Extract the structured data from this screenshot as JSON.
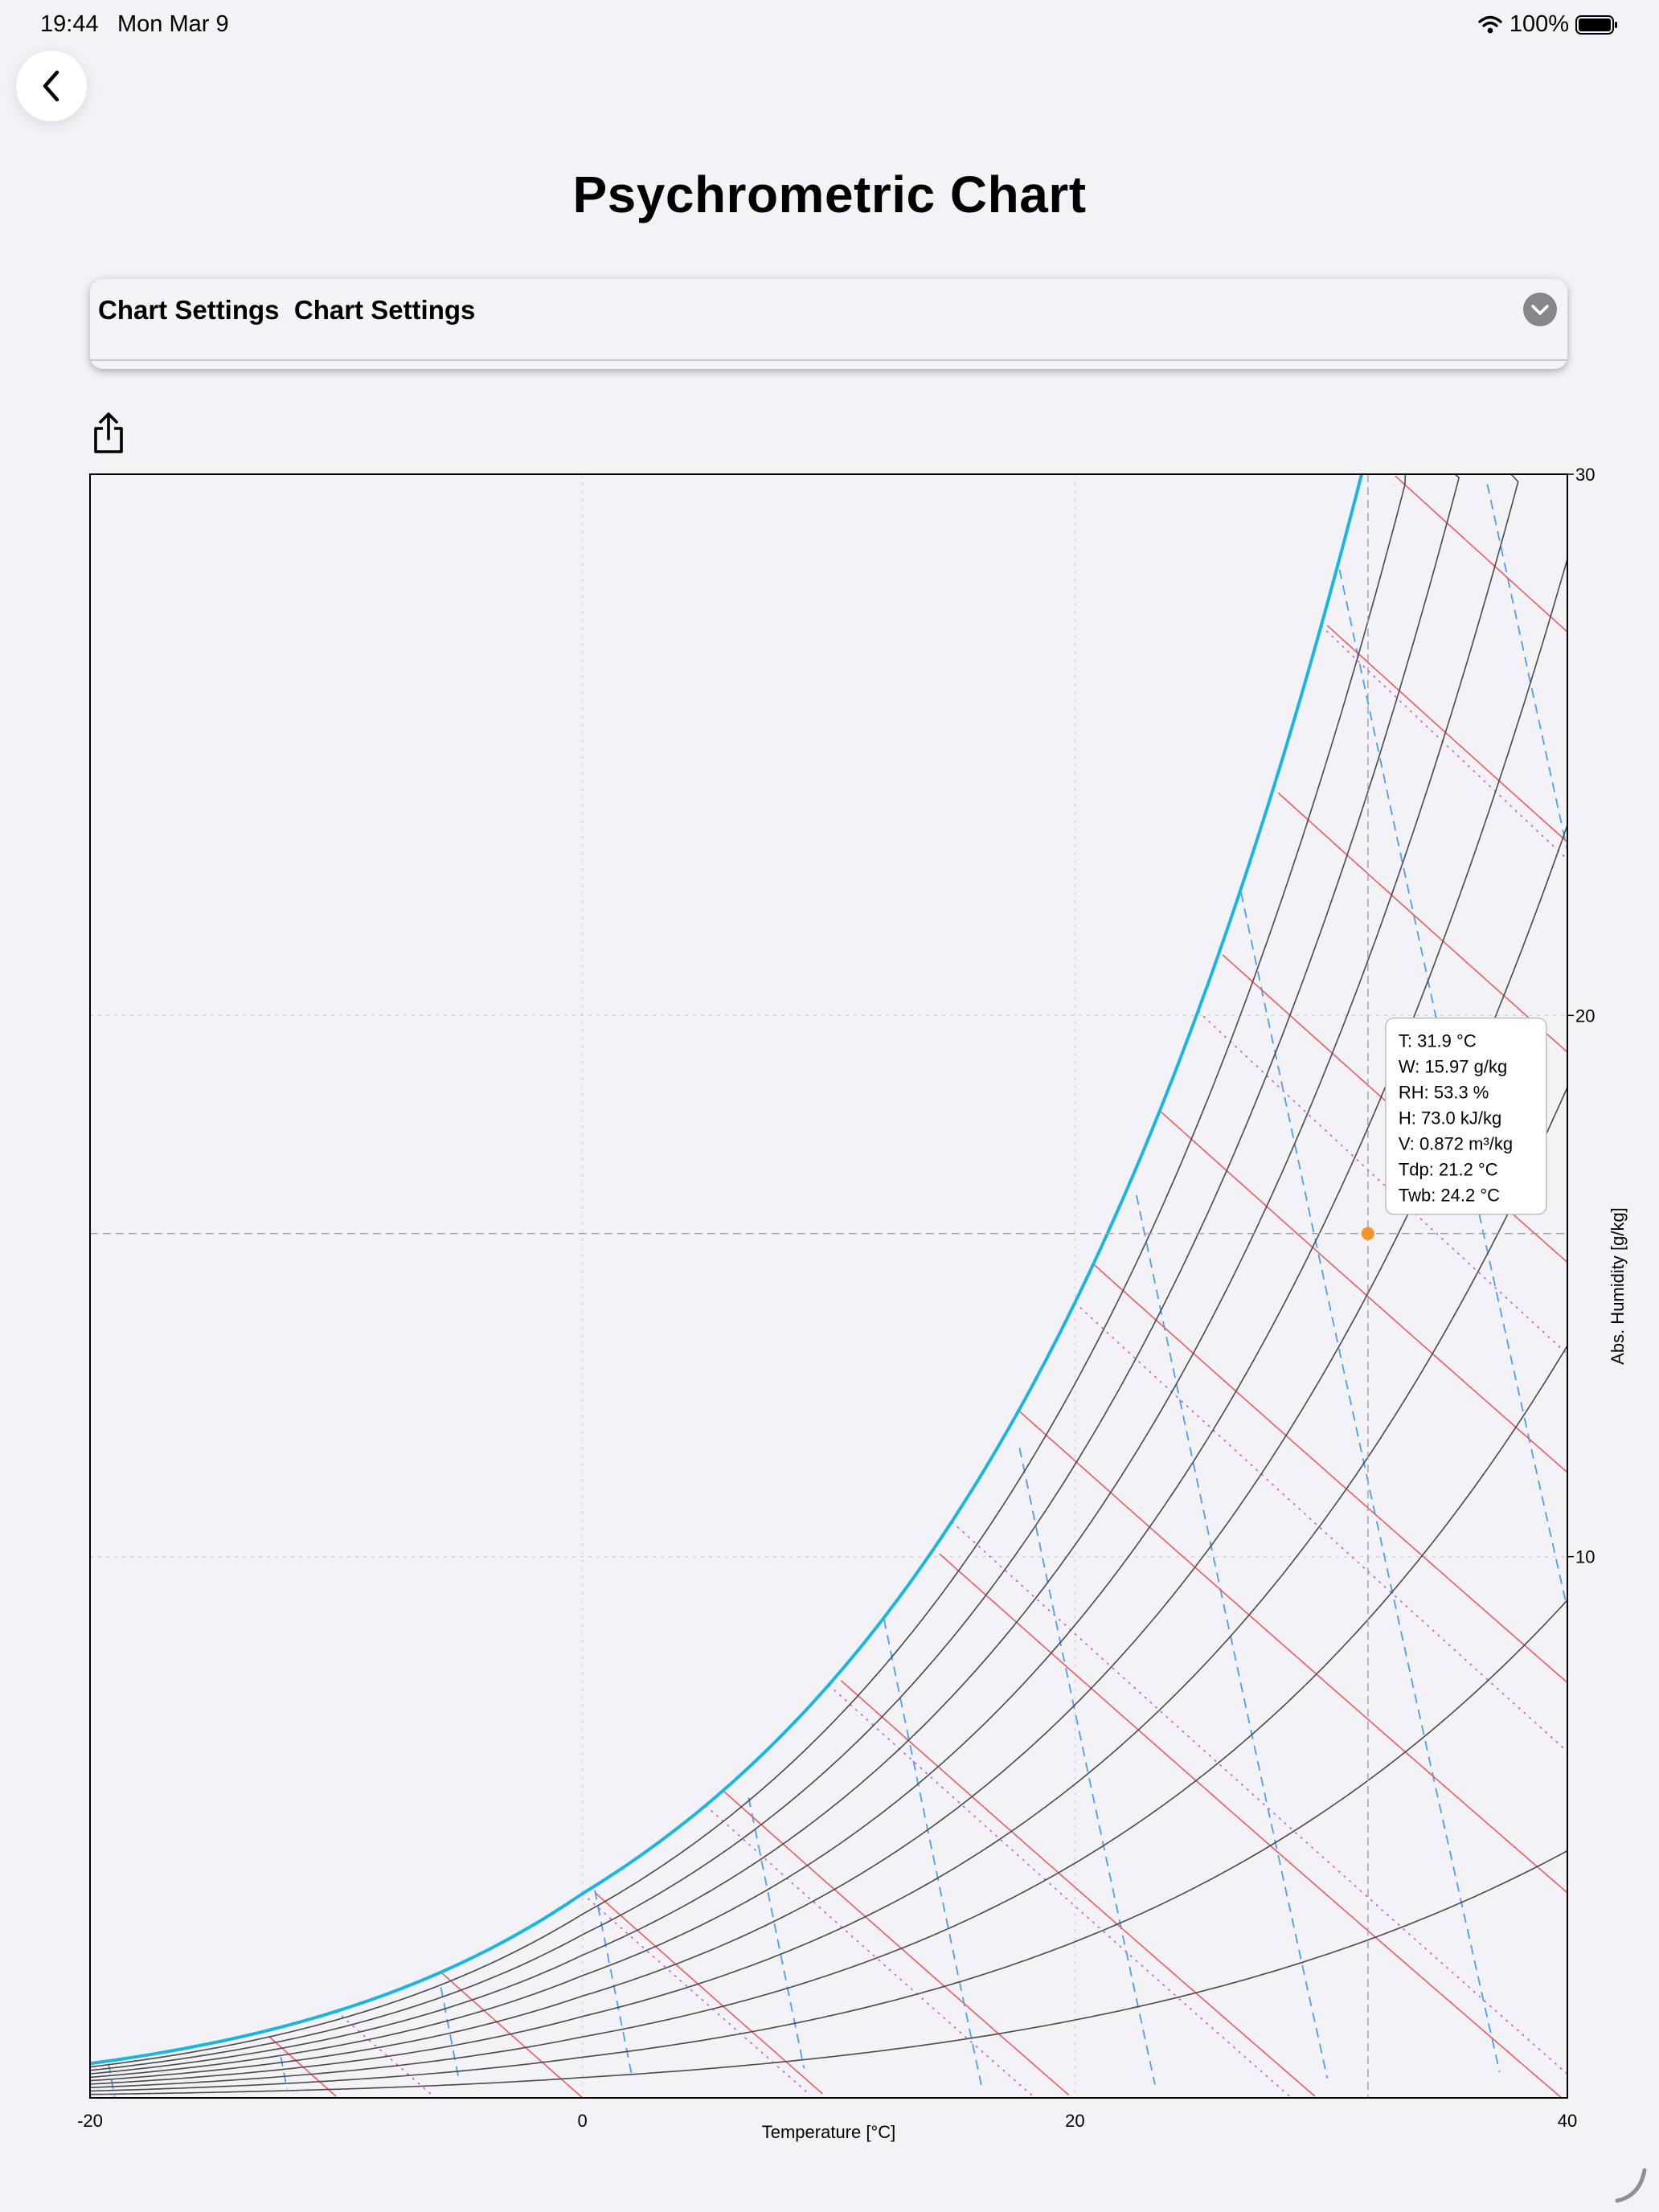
{
  "status_bar": {
    "time": "19:44",
    "date": "Mon Mar 9",
    "battery": "100%"
  },
  "header": {
    "title": "Psychrometric Chart",
    "back_icon": "chevron-left-icon"
  },
  "settings": {
    "title": "Chart Settings  Chart Settings",
    "expand_icon": "chevron-down-icon"
  },
  "toolbar": {
    "share_icon": "share-icon"
  },
  "colors": {
    "saturation": "#1bb5e0",
    "rh": "#4a4a4a",
    "enthalpy": "#f05a5a",
    "wet_bulb": "#c25be8",
    "volume": "#4a9ff5",
    "point": "#f5922b"
  },
  "chart_data": {
    "type": "psychrometric",
    "title": "",
    "xlabel": "Temperature [°C]",
    "ylabel": "Abs. Humidity [g/kg]",
    "xlim": [
      -20,
      40
    ],
    "ylim": [
      0,
      30
    ],
    "x_ticks": [
      "-20",
      "0",
      "20",
      "40"
    ],
    "y_ticks": [
      "10",
      "20",
      "30"
    ],
    "grid": true,
    "rh_levels": [
      100,
      90,
      80,
      70,
      60,
      50,
      40,
      30,
      20,
      10
    ],
    "enthalpy_levels": [
      -10,
      0,
      10,
      20,
      30,
      40,
      50,
      60,
      70,
      80,
      90,
      100,
      110,
      120
    ],
    "wet_bulb_levels": [
      -10,
      0,
      5,
      10,
      15,
      20,
      25,
      30
    ],
    "volume_levels": [
      0.72,
      0.74,
      0.76,
      0.78,
      0.8,
      0.82,
      0.84,
      0.86,
      0.88,
      0.9,
      0.92,
      0.94
    ],
    "selected_point": {
      "t": 31.9,
      "w": 15.97
    },
    "tooltip": [
      "T: 31.9 °C",
      "W: 15.97 g/kg",
      "RH: 53.3 %",
      "H: 73.0 kJ/kg",
      "V: 0.872 m³/kg",
      "Tdp: 21.2 °C",
      "Twb: 24.2 °C"
    ]
  }
}
